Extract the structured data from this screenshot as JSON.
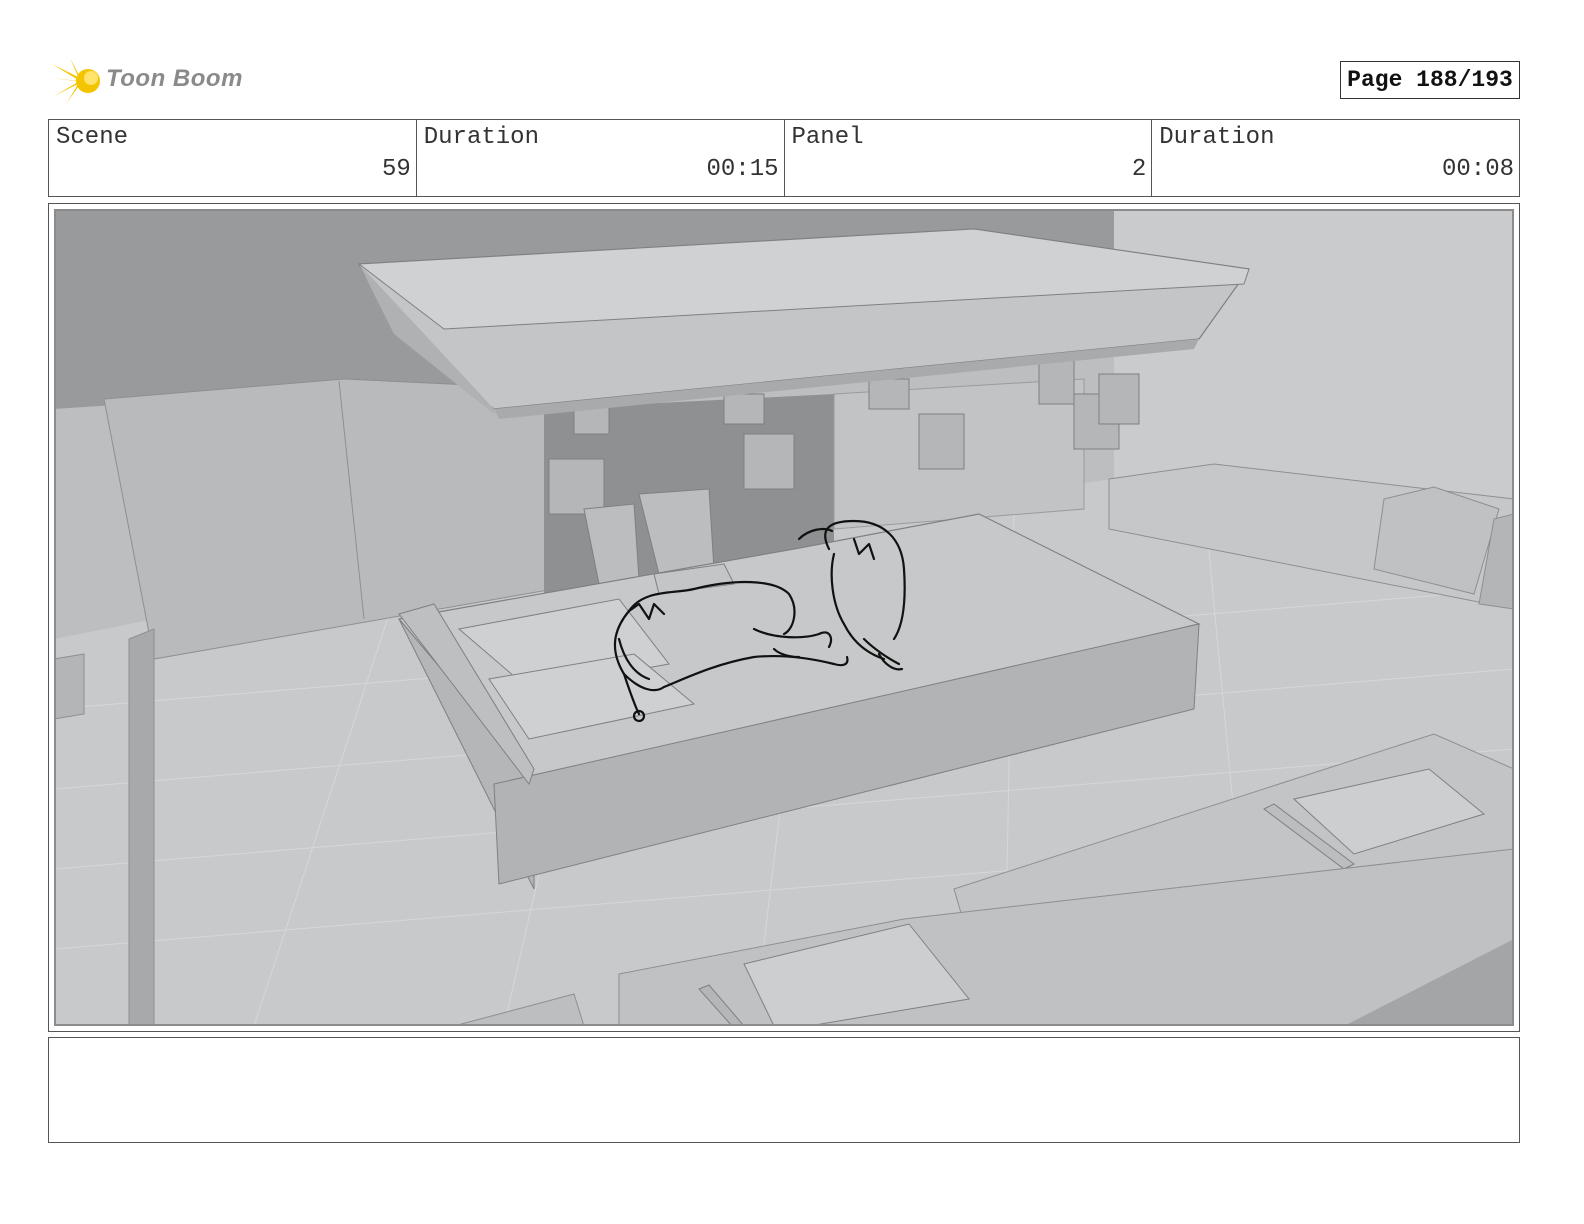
{
  "header": {
    "logo_text": "Toon Boom",
    "page_label": "Page 188/193"
  },
  "info": {
    "scene_label": "Scene",
    "scene_value": "59",
    "scene_duration_label": "Duration",
    "scene_duration_value": "00:15",
    "panel_label": "Panel",
    "panel_value": "2",
    "panel_duration_label": "Duration",
    "panel_duration_value": "00:08"
  },
  "panel": {
    "description": ""
  },
  "notes": {
    "text": ""
  },
  "colors": {
    "logo_sun": "#f5c400",
    "logo_text": "#8a8a8a",
    "scene_background": "#bfc0c1",
    "border": "#555555"
  }
}
